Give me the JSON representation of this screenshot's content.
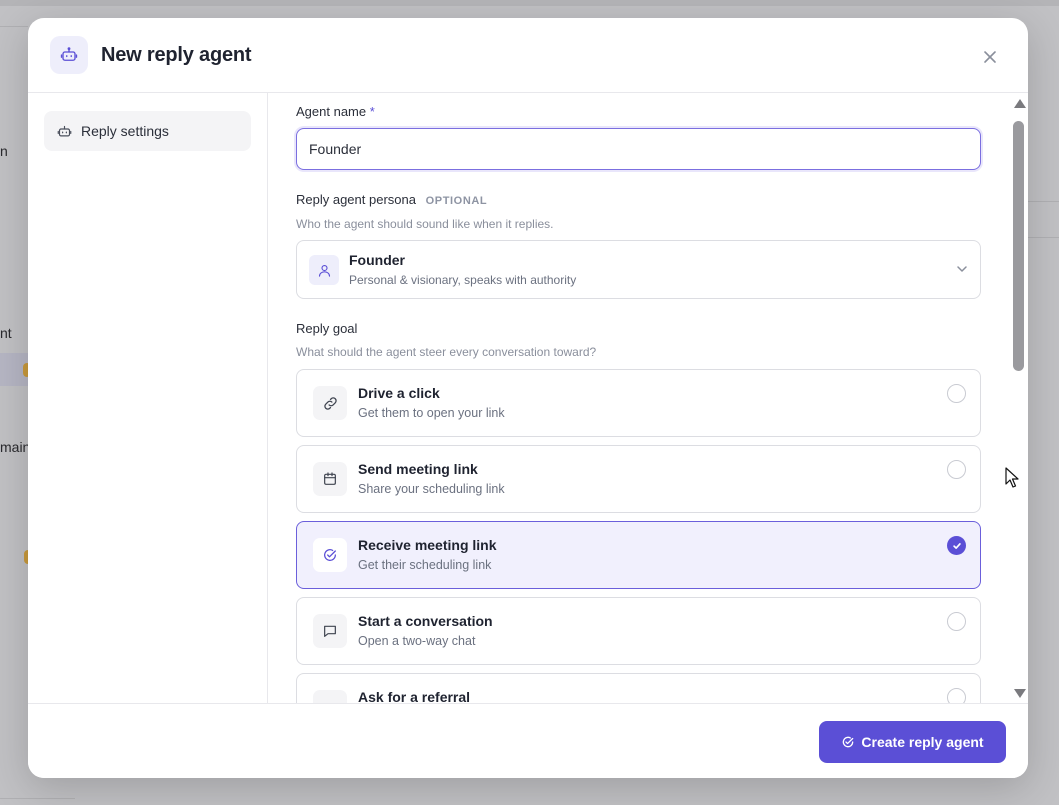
{
  "background": {
    "fragments": [
      "n",
      "nt",
      "main"
    ]
  },
  "modal": {
    "title": "New reply agent",
    "header_icon": "robot-icon",
    "close_icon": "close-icon"
  },
  "sidebar": {
    "items": [
      {
        "label": "Reply settings",
        "icon": "robot-icon",
        "active": true
      }
    ]
  },
  "form": {
    "agent_name": {
      "label": "Agent name",
      "required_mark": "*",
      "value": "Founder"
    },
    "persona": {
      "label": "Reply agent persona",
      "optional_tag": "OPTIONAL",
      "helper": "Who the agent should sound like when it replies.",
      "selected_name": "Founder",
      "selected_desc": "Personal & visionary, speaks with authority",
      "icon": "user-icon"
    },
    "goal": {
      "label": "Reply goal",
      "helper": "What should the agent steer every conversation toward?",
      "options": [
        {
          "title": "Drive a click",
          "desc": "Get them to open your link",
          "icon": "link-icon",
          "selected": false
        },
        {
          "title": "Send meeting link",
          "desc": "Share your scheduling link",
          "icon": "calendar-icon",
          "selected": false
        },
        {
          "title": "Receive meeting link",
          "desc": "Get their scheduling link",
          "icon": "check-circle-icon",
          "selected": true
        },
        {
          "title": "Start a conversation",
          "desc": "Open a two-way chat",
          "icon": "chat-icon",
          "selected": false
        },
        {
          "title": "Ask for a referral",
          "desc": "",
          "icon": "users-icon",
          "selected": false
        }
      ]
    }
  },
  "footer": {
    "create_label": "Create reply agent",
    "create_icon": "check-circle-icon"
  },
  "colors": {
    "accent": "#5b4fd6",
    "accent_light": "#f1f0fd",
    "border": "#dcdde2"
  }
}
